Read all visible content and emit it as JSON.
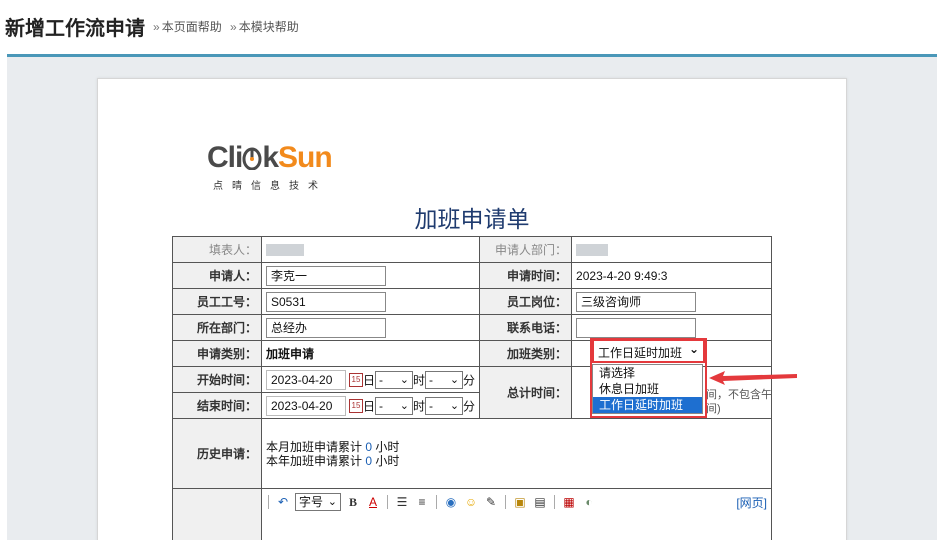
{
  "header": {
    "title": "新增工作流申请",
    "help_page": "本页面帮助",
    "help_module": "本模块帮助"
  },
  "logo": {
    "word_a": "Cli",
    "word_b": "k",
    "word_c": "Sun",
    "subtitle": "点晴信息技术"
  },
  "form": {
    "title": "加班申请单",
    "filler_label": "填表人：",
    "dept_of_applicant_label": "申请人部门：",
    "applicant_label": "申请人：",
    "applicant_value": "李克一",
    "apply_time_label": "申请时间：",
    "apply_time_value": "2023-4-20 9:49:3",
    "emp_no_label": "员工工号：",
    "emp_no_value": "S0531",
    "post_label": "员工岗位：",
    "post_value": "三级咨询师",
    "dept_label": "所在部门：",
    "dept_value": "总经办",
    "phone_label": "联系电话：",
    "phone_value": "",
    "apply_type_label": "申请类别：",
    "apply_type_value": "加班申请",
    "ot_type_label": "加班类别：",
    "start_label": "开始时间：",
    "start_date": "2023-04-20",
    "end_label": "结束时间：",
    "end_date": "2023-04-20",
    "cal_glyph": "15",
    "day_unit": "日",
    "hour_unit": "时",
    "minute_unit": "分",
    "select_placeholder": "-",
    "total_label": "总计时间：",
    "total_note_line1": "间，不包含午",
    "total_note_line2": "间)",
    "history_label": "历史申请：",
    "history_month_prefix": "本月加班申请累计",
    "history_month_value": "0",
    "history_month_unit": "小时",
    "history_year_prefix": "本年加班申请累计",
    "history_year_value": "0",
    "history_year_unit": "小时"
  },
  "dropdown": {
    "selected": "工作日延时加班",
    "options": [
      "请选择",
      "休息日加班",
      "工作日延时加班"
    ],
    "active_index": 2
  },
  "editor": {
    "font_size_select": "字号",
    "bold": "B",
    "font_color": "A",
    "webpage_link": "[网页]"
  },
  "colors": {
    "accent": "#4a97b8",
    "highlight": "#e4393c",
    "brand_orange": "#f28a1c",
    "selected_option": "#1e6fd0"
  }
}
